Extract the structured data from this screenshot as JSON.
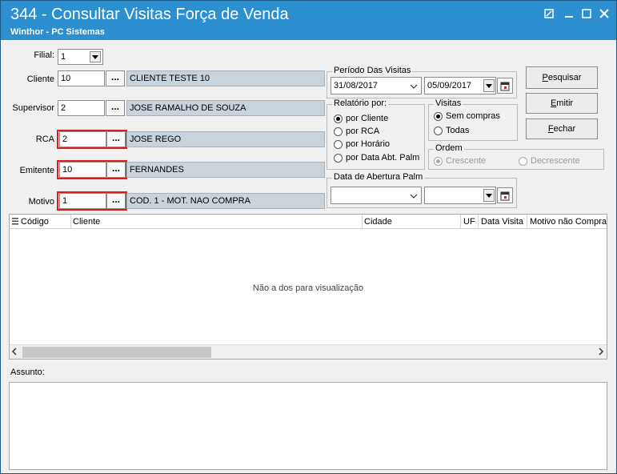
{
  "window": {
    "title": "344 - Consultar Visitas Força de Venda",
    "subtitle": "Winthor - PC Sistemas",
    "controls": [
      "restore-icon",
      "minimize-icon",
      "maximize-icon",
      "close-icon"
    ]
  },
  "form": {
    "filial_label": "Filial:",
    "filial_value": "1",
    "cliente_label": "Cliente",
    "cliente_code": "10",
    "cliente_desc": "CLIENTE TESTE 10",
    "supervisor_label": "Supervisor",
    "supervisor_code": "2",
    "supervisor_desc": "JOSE RAMALHO DE SOUZA",
    "rca_label": "RCA",
    "rca_code": "2",
    "rca_desc": "JOSE REGO",
    "emitente_label": "Emitente",
    "emitente_code": "10",
    "emitente_desc": "FERNANDES",
    "motivo_label": "Motivo",
    "motivo_code": "1",
    "motivo_desc": "COD. 1 - MOT. NAO COMPRA",
    "lookup_label": "..."
  },
  "periodo": {
    "title": "Período Das Visitas",
    "start": "31/08/2017",
    "end": "05/09/2017"
  },
  "relatorio": {
    "title": "Relatório por:",
    "options": [
      "por Cliente",
      "por RCA",
      "por Horário",
      "por Data Abt. Palm"
    ],
    "selected": 0
  },
  "visitas": {
    "title": "Visitas",
    "options": [
      "Sem compras",
      "Todas"
    ],
    "selected": 0
  },
  "ordem": {
    "title": "Ordem",
    "options": [
      "Crescente",
      "Decrescente"
    ],
    "selected": 0
  },
  "abertura": {
    "title": "Data de Abertura Palm",
    "start": "",
    "end": ""
  },
  "buttons": {
    "pesquisar_u": "P",
    "pesquisar_rest": "esquisar",
    "emitir_u": "E",
    "emitir_rest": "mitir",
    "fechar_u": "F",
    "fechar_rest": "echar"
  },
  "grid": {
    "columns": [
      "Código",
      "Cliente",
      "Cidade",
      "UF",
      "Data Visita",
      "Motivo não Compra"
    ],
    "empty_text": "Não a dos para visualização"
  },
  "assunto": {
    "label": "Assunto:",
    "value": ""
  },
  "colors": {
    "titlebar": "#2b8fd0",
    "highlight": "#e01b1b",
    "desc_field": "#c9d3dc"
  }
}
